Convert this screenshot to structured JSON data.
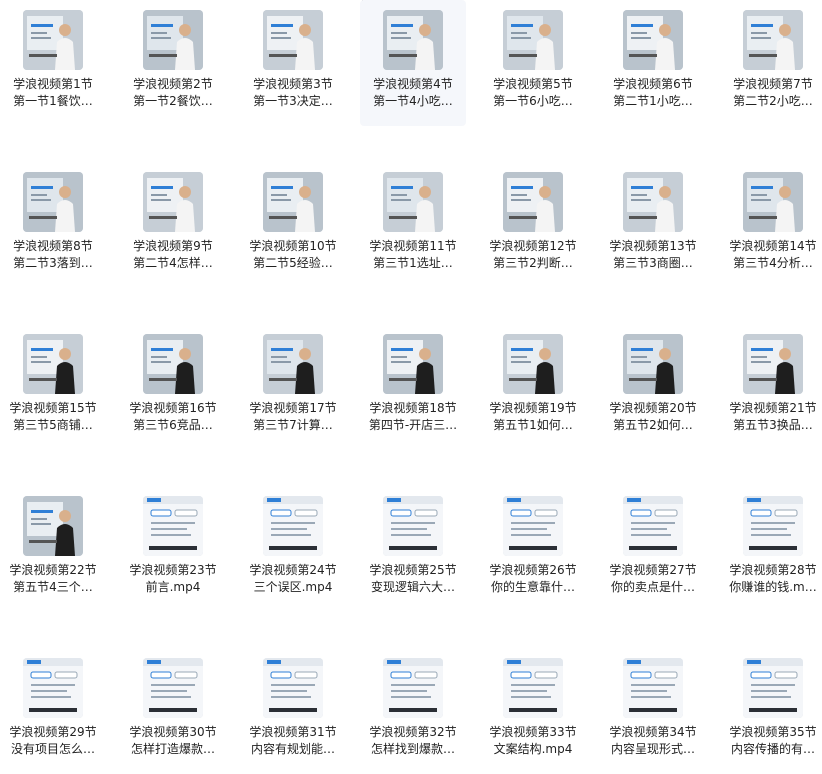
{
  "files": [
    {
      "line1": "学浪视频第1节",
      "line2": "第一节1餐饮…",
      "thumb": "lecture-video-thumbnail"
    },
    {
      "line1": "学浪视频第2节",
      "line2": "第一节2餐饮…",
      "thumb": "lecture-video-thumbnail"
    },
    {
      "line1": "学浪视频第3节",
      "line2": "第一节3决定…",
      "thumb": "lecture-video-thumbnail"
    },
    {
      "line1": "学浪视频第4节",
      "line2": "第一节4小吃…",
      "thumb": "lecture-video-thumbnail"
    },
    {
      "line1": "学浪视频第5节",
      "line2": "第一节6小吃…",
      "thumb": "lecture-video-thumbnail"
    },
    {
      "line1": "学浪视频第6节",
      "line2": "第二节1小吃…",
      "thumb": "lecture-video-thumbnail"
    },
    {
      "line1": "学浪视频第7节",
      "line2": "第二节2小吃…",
      "thumb": "lecture-video-thumbnail"
    },
    {
      "line1": "学浪视频第8节",
      "line2": "第二节3落到…",
      "thumb": "lecture-video-thumbnail"
    },
    {
      "line1": "学浪视频第9节",
      "line2": "第二节4怎样…",
      "thumb": "lecture-video-thumbnail"
    },
    {
      "line1": "学浪视频第10节",
      "line2": "第二节5经验…",
      "thumb": "lecture-video-thumbnail"
    },
    {
      "line1": "学浪视频第11节",
      "line2": "第三节1选址…",
      "thumb": "lecture-video-thumbnail"
    },
    {
      "line1": "学浪视频第12节",
      "line2": "第三节2判断…",
      "thumb": "lecture-video-thumbnail"
    },
    {
      "line1": "学浪视频第13节",
      "line2": "第三节3商圈…",
      "thumb": "lecture-video-thumbnail"
    },
    {
      "line1": "学浪视频第14节",
      "line2": "第三节4分析…",
      "thumb": "lecture-video-thumbnail"
    },
    {
      "line1": "学浪视频第15节",
      "line2": "第三节5商铺…",
      "thumb": "lecture-video-thumbnail"
    },
    {
      "line1": "学浪视频第16节",
      "line2": "第三节6竞品…",
      "thumb": "lecture-video-thumbnail"
    },
    {
      "line1": "学浪视频第17节",
      "line2": "第三节7计算…",
      "thumb": "lecture-video-thumbnail"
    },
    {
      "line1": "学浪视频第18节",
      "line2": "第四节-开店三…",
      "thumb": "lecture-video-thumbnail"
    },
    {
      "line1": "学浪视频第19节",
      "line2": "第五节1如何…",
      "thumb": "lecture-video-thumbnail"
    },
    {
      "line1": "学浪视频第20节",
      "line2": "第五节2如何…",
      "thumb": "lecture-video-thumbnail"
    },
    {
      "line1": "学浪视频第21节",
      "line2": "第五节3换品…",
      "thumb": "lecture-video-thumbnail"
    },
    {
      "line1": "学浪视频第22节",
      "line2": "第五节4三个…",
      "thumb": "lecture-video-thumbnail"
    },
    {
      "line1": "学浪视频第23节",
      "line2": "前言.mp4",
      "thumb": "slide-thumbnail"
    },
    {
      "line1": "学浪视频第24节",
      "line2": "三个误区.mp4",
      "thumb": "slide-thumbnail"
    },
    {
      "line1": "学浪视频第25节",
      "line2": "变现逻辑六大…",
      "thumb": "slide-thumbnail"
    },
    {
      "line1": "学浪视频第26节",
      "line2": "你的生意靠什…",
      "thumb": "slide-thumbnail"
    },
    {
      "line1": "学浪视频第27节",
      "line2": "你的卖点是什…",
      "thumb": "slide-thumbnail"
    },
    {
      "line1": "学浪视频第28节",
      "line2": "你赚谁的钱.m…",
      "thumb": "slide-thumbnail"
    },
    {
      "line1": "学浪视频第29节",
      "line2": "没有项目怎么…",
      "thumb": "slide-thumbnail"
    },
    {
      "line1": "学浪视频第30节",
      "line2": "怎样打造爆款…",
      "thumb": "slide-thumbnail"
    },
    {
      "line1": "学浪视频第31节",
      "line2": "内容有规划能…",
      "thumb": "slide-thumbnail"
    },
    {
      "line1": "学浪视频第32节",
      "line2": "怎样找到爆款…",
      "thumb": "slide-thumbnail"
    },
    {
      "line1": "学浪视频第33节",
      "line2": "文案结构.mp4",
      "thumb": "slide-thumbnail"
    },
    {
      "line1": "学浪视频第34节",
      "line2": "内容呈现形式…",
      "thumb": "slide-thumbnail"
    },
    {
      "line1": "学浪视频第35节",
      "line2": "内容传播的有…",
      "thumb": "slide-thumbnail"
    }
  ],
  "selected_index": 3,
  "colors": {
    "accent": "#2f7fd6",
    "selected_bg": "#f5f7fb",
    "text": "#222222"
  }
}
